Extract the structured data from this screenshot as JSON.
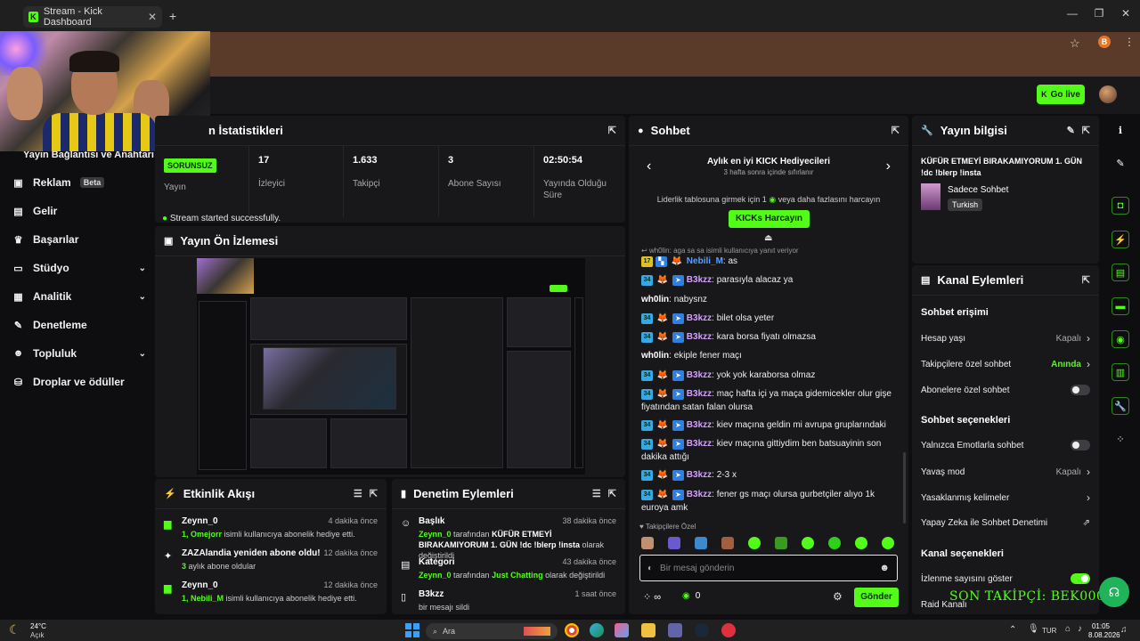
{
  "browser": {
    "tab_title": "Stream - Kick Dashboard",
    "tab_favicon": "K",
    "new_tab": "+",
    "profile_initial": "B",
    "window_controls": [
      "—",
      "❐",
      "✕"
    ]
  },
  "topbar": {
    "go_live_label": "Go live"
  },
  "sidebar": {
    "partial_label": "Yayın Bağlantısı ve Anahtarı",
    "items": [
      {
        "label": "Reklam",
        "badge": "Beta",
        "icon": "ad-icon"
      },
      {
        "label": "Gelir",
        "icon": "revenue-icon"
      },
      {
        "label": "Başarılar",
        "icon": "trophy-icon"
      },
      {
        "label": "Stüdyo",
        "icon": "studio-icon",
        "expandable": true
      },
      {
        "label": "Analitik",
        "icon": "analytics-icon",
        "expandable": true
      },
      {
        "label": "Denetleme",
        "icon": "moderation-icon"
      },
      {
        "label": "Topluluk",
        "icon": "community-icon",
        "expandable": true
      },
      {
        "label": "Droplar ve ödüller",
        "icon": "drops-icon"
      }
    ]
  },
  "stats": {
    "title": "n İstatistikleri",
    "status_badge": "SORUNSUZ",
    "cells": [
      {
        "value": "",
        "label": "Yayın"
      },
      {
        "value": "17",
        "label": "İzleyici"
      },
      {
        "value": "1.633",
        "label": "Takipçi"
      },
      {
        "value": "3",
        "label": "Abone Sayısı"
      },
      {
        "value": "02:50:54",
        "label": "Yayında Olduğu Süre"
      }
    ],
    "success_message": "Stream started successfully."
  },
  "preview": {
    "title": "Yayın Ön İzlemesi"
  },
  "activity": {
    "title": "Etkinlik Akışı",
    "items": [
      {
        "title": "Zeynn_0",
        "time": "4 dakika önce",
        "sub_highlight": "1, Omejorr",
        "sub_rest": " isimli kullanıcıya abonelik hediye etti.",
        "icon": "gift-icon"
      },
      {
        "title": "ZAZAlandia yeniden abone oldu!",
        "time": "12 dakika önce",
        "sub_highlight": "3",
        "sub_rest": " aylık abone oldular",
        "icon": "sparkle-icon"
      },
      {
        "title": "Zeynn_0",
        "time": "12 dakika önce",
        "sub_highlight": "1, Nebili_M",
        "sub_rest": " isimli kullanıcıya abonelik hediye etti.",
        "icon": "gift-icon"
      }
    ]
  },
  "moderation": {
    "title": "Denetim Eylemleri",
    "items": [
      {
        "title": "Başlık",
        "time": "38 dakika önce",
        "actor": "Zeynn_0",
        "mid": " tarafından ",
        "target": "KÜFÜR ETMEYİ BIRAKAMIYORUM 1. GÜN !dc !blerp !insta",
        "tail": " olarak değiştirildi",
        "icon": "user-edit-icon"
      },
      {
        "title": "Kategori",
        "time": "43 dakika önce",
        "actor": "Zeynn_0",
        "mid": " tarafından ",
        "target": "Just Chatting",
        "tail": " olarak değiştirildi",
        "icon": "category-icon"
      },
      {
        "title": "B3kzz",
        "time": "1 saat önce",
        "actor": "",
        "mid": "bir mesajı sildi",
        "target": "",
        "tail": "",
        "icon": "delete-icon"
      }
    ]
  },
  "chat": {
    "title": "Sohbet",
    "gifters_title": "Aylık en iyi KICK Hediyecileri",
    "gifters_sub": "3 hafta sonra içinde sıfırlanır",
    "leaderboard_prefix": "Liderlik tablosuna girmek için 1",
    "leaderboard_suffix": "veya daha fazlasını harcayın",
    "spend_button": "KICKs Harcayın",
    "reply_hint": "wh0lin: aga sa sa isimli kullanıcıya yanıt veriyor",
    "messages": [
      {
        "user": "Nebili_M",
        "text": "as",
        "style": "blue",
        "badges": "17"
      },
      {
        "user": "B3kzz",
        "text": "parasıyla alacaz ya",
        "style": "purple",
        "badges": "34"
      },
      {
        "user": "wh0lin",
        "text": "nabysnz",
        "style": "white",
        "badges": ""
      },
      {
        "user": "B3kzz",
        "text": "bilet olsa yeter",
        "style": "purple",
        "badges": "34"
      },
      {
        "user": "B3kzz",
        "text": "kara borsa fiyatı olmazsa",
        "style": "purple",
        "badges": "34"
      },
      {
        "user": "wh0lin",
        "text": "ekiple fener maçı",
        "style": "white",
        "badges": ""
      },
      {
        "user": "B3kzz",
        "text": "yok yok karaborsa olmaz",
        "style": "purple",
        "badges": "34"
      },
      {
        "user": "B3kzz",
        "text": "maç hafta içi ya maça gidemicekler olur gişe fiyatından satan falan olursa",
        "style": "purple",
        "badges": "34"
      },
      {
        "user": "B3kzz",
        "text": "kiev maçına geldin mi avrupa gruplarındaki",
        "style": "purple",
        "badges": "34"
      },
      {
        "user": "B3kzz",
        "text": "kiev maçına gittiydim ben batsuayinin son dakika attığı",
        "style": "purple",
        "badges": "34"
      },
      {
        "user": "B3kzz",
        "text": "2-3 x",
        "style": "purple",
        "badges": "34"
      },
      {
        "user": "B3kzz",
        "text": "fener gs maçı olursa gurbetçiler alıyo 1k euroya amk",
        "style": "purple",
        "badges": "34"
      }
    ],
    "followers_only": "Takipçilere Özel",
    "input_placeholder": "Bir mesaj gönderin",
    "points": "0",
    "send_button": "Gönder"
  },
  "stream_info": {
    "title": "Yayın bilgisi",
    "stream_title": "KÜFÜR ETMEYİ BIRAKAMIYORUM 1. GÜN !dc !blerp !insta",
    "category": "Sadece Sohbet",
    "language": "Turkish"
  },
  "channel_actions": {
    "title": "Kanal Eylemleri",
    "chat_access_heading": "Sohbet erişimi",
    "rows_access": [
      {
        "label": "Hesap yaşı",
        "value": "Kapalı",
        "control": "chevron"
      },
      {
        "label": "Takipçilere özel sohbet",
        "value": "Anında",
        "control": "chevron",
        "green": true
      },
      {
        "label": "Abonelere özel sohbet",
        "value": "",
        "control": "toggle",
        "on": false
      }
    ],
    "chat_options_heading": "Sohbet seçenekleri",
    "rows_options": [
      {
        "label": "Yalnızca Emotlarla sohbet",
        "value": "",
        "control": "toggle",
        "on": false
      },
      {
        "label": "Yavaş mod",
        "value": "Kapalı",
        "control": "chevron"
      },
      {
        "label": "Yasaklanmış kelimeler",
        "value": "",
        "control": "chevron"
      },
      {
        "label": "Yapay Zeka ile Sohbet Denetimi",
        "value": "",
        "control": "external"
      }
    ],
    "channel_options_heading": "Kanal seçenekleri",
    "rows_channel": [
      {
        "label": "İzlenme sayısını göster",
        "value": "",
        "control": "toggle",
        "on": true
      },
      {
        "label": "Raid Kanalı",
        "value": "",
        "control": "none"
      }
    ],
    "overlay_text": "SON TAKİPÇİ: BEK000"
  },
  "taskbar": {
    "weather_temp": "24°C",
    "weather_desc": "Açık",
    "search_placeholder": "Ara",
    "language": "TUR",
    "time": "01:05",
    "date": "8.08.2026"
  },
  "colors": {
    "accent": "#53fc18",
    "panel": "#18181b",
    "background": "#0e0e10"
  }
}
